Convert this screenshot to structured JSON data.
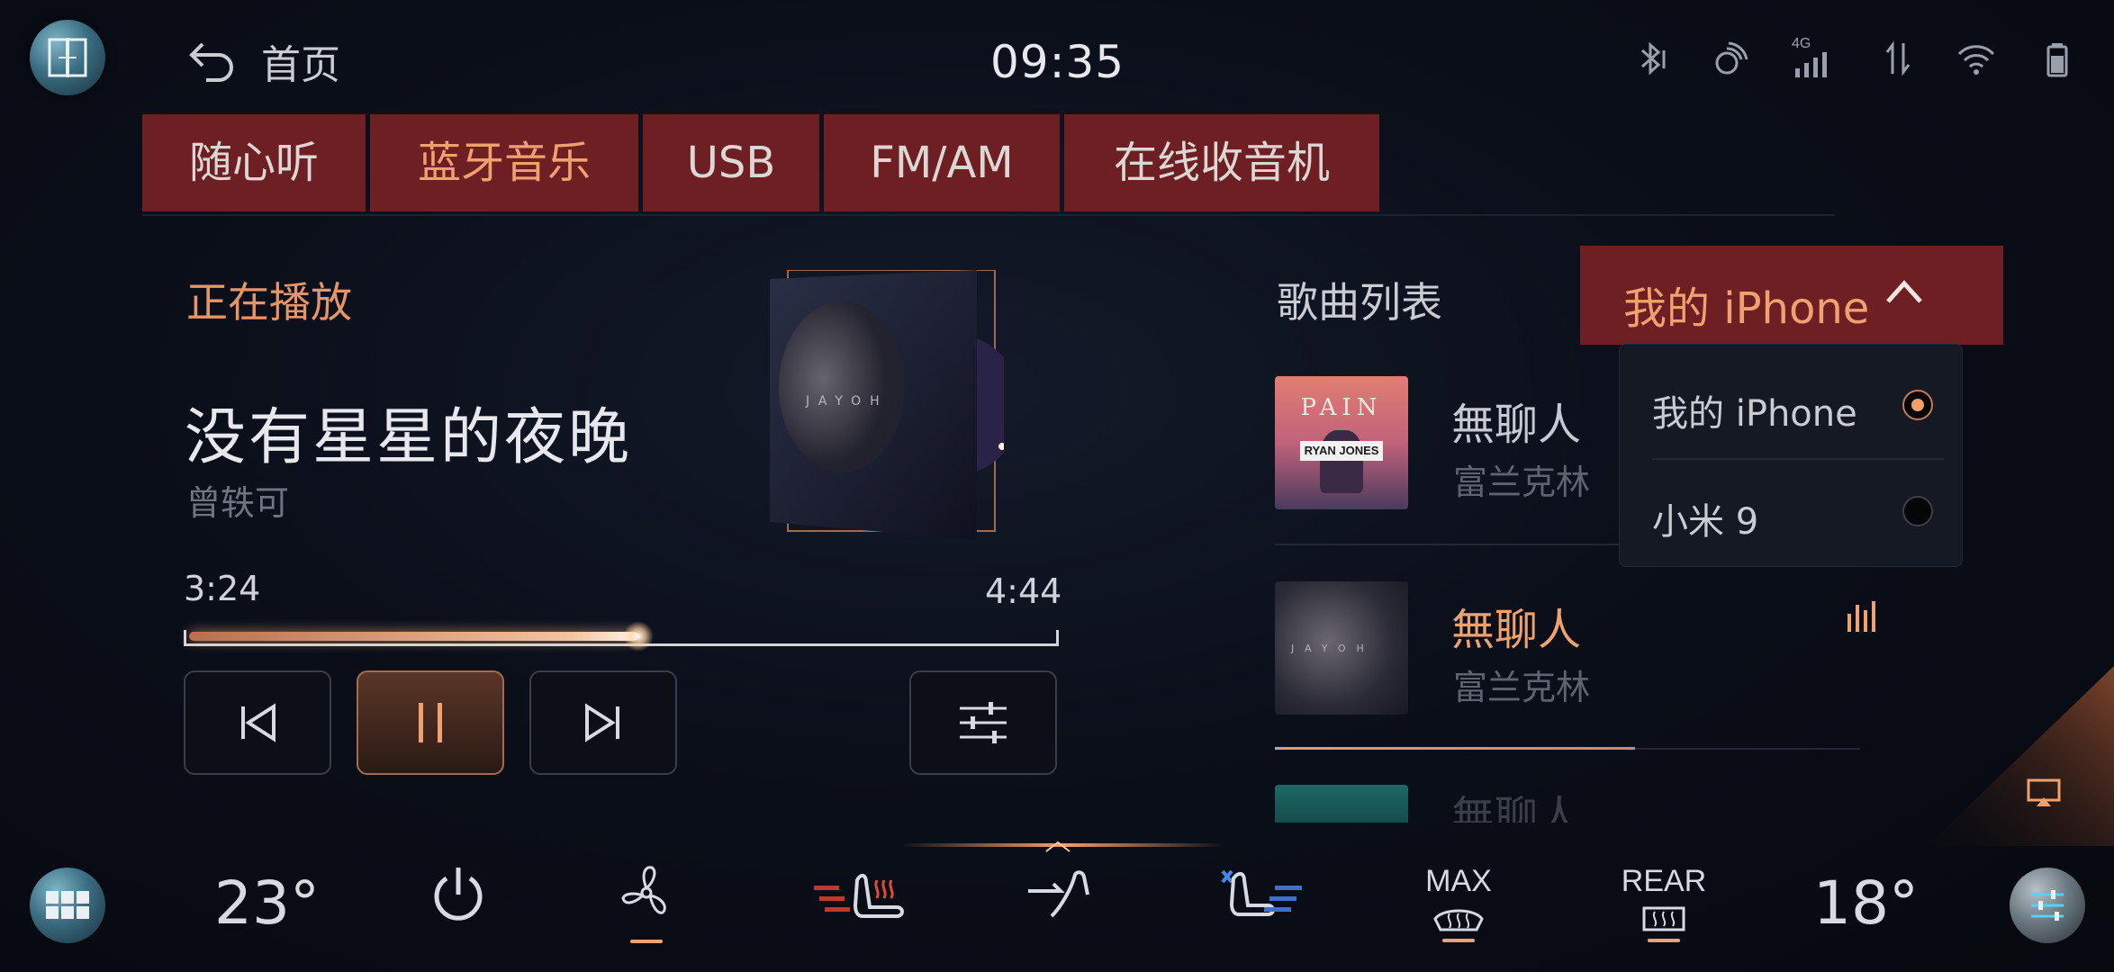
{
  "header": {
    "back_label": "首页",
    "time": "09:35",
    "network_label": "4G"
  },
  "tabs": [
    {
      "label": "随心听",
      "active": false
    },
    {
      "label": "蓝牙音乐",
      "active": true
    },
    {
      "label": "USB",
      "active": false
    },
    {
      "label": "FM/AM",
      "active": false
    },
    {
      "label": "在线收音机",
      "active": false
    }
  ],
  "now_playing": {
    "section_label": "正在播放",
    "title": "没有星星的夜晚",
    "artist": "曾轶可",
    "elapsed": "3:24",
    "total": "4:44",
    "progress_fraction": 0.52,
    "album_text": "JAYOH"
  },
  "playlist": {
    "label": "歌曲列表",
    "device_selected": "我的 iPhone",
    "devices": [
      {
        "name": "我的 iPhone",
        "selected": true
      },
      {
        "name": "小米 9",
        "selected": false
      }
    ],
    "songs": [
      {
        "title": "無聊人",
        "artist": "富兰克林",
        "art_text_top": "PAIN",
        "art_text_band": "RYAN JONES",
        "playing": false
      },
      {
        "title": "無聊人",
        "artist": "富兰克林",
        "art_text_top": "JAYOH",
        "playing": true
      },
      {
        "title": "無聊人",
        "artist": "",
        "playing": false
      }
    ]
  },
  "climate": {
    "left_temp": "23°",
    "right_temp": "18°",
    "max_label": "MAX",
    "rear_label": "REAR"
  },
  "colors": {
    "accent": "#f0a170",
    "tab_bg": "#6e1f24",
    "background": "#0b0f1a"
  }
}
